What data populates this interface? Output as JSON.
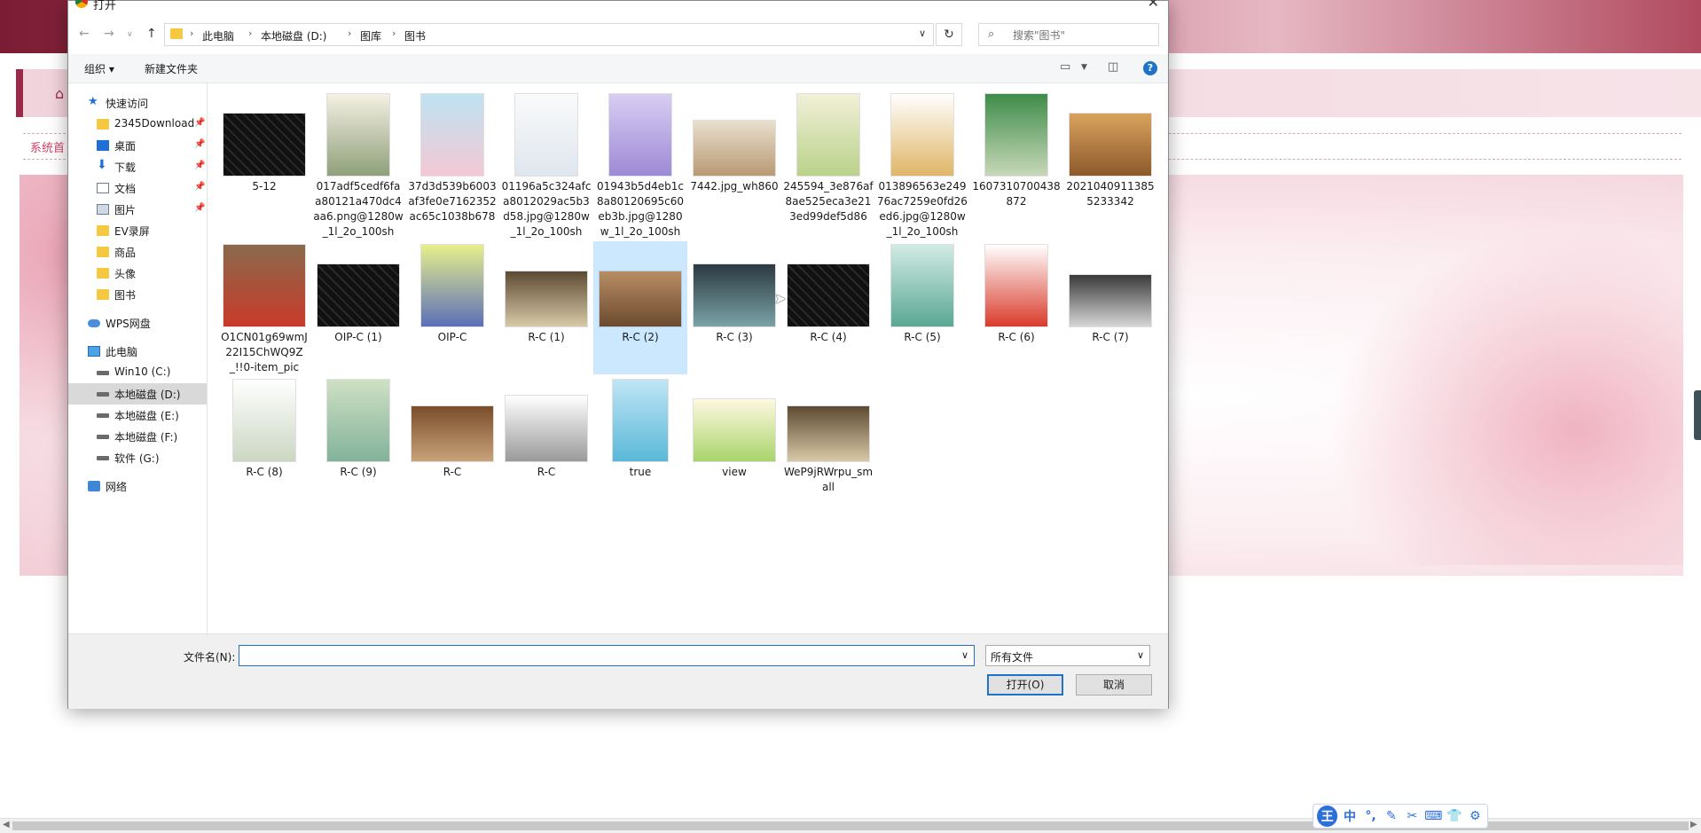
{
  "background_page": {
    "breadcrumb_text": "系统首"
  },
  "dialog": {
    "title": "打开",
    "close_glyph": "✕",
    "address": {
      "crumbs": [
        "此电脑",
        "本地磁盘 (D:)",
        "图库",
        "图书"
      ]
    },
    "search": {
      "placeholder": "搜索\"图书\""
    },
    "toolbar": {
      "organize_label": "组织 ▾",
      "new_folder_label": "新建文件夹",
      "help_label": "?"
    },
    "sidebar": {
      "items": [
        {
          "label": "快速访问",
          "icon": "star-icon",
          "pinned": false
        },
        {
          "label": "2345Download",
          "icon": "folder-icon",
          "pinned": true
        },
        {
          "label": "桌面",
          "icon": "desktop-icon",
          "pinned": true
        },
        {
          "label": "下载",
          "icon": "download-icon",
          "pinned": true
        },
        {
          "label": "文档",
          "icon": "document-icon",
          "pinned": true
        },
        {
          "label": "图片",
          "icon": "pictures-icon",
          "pinned": true
        },
        {
          "label": "EV录屏",
          "icon": "folder-icon",
          "pinned": false
        },
        {
          "label": "商品",
          "icon": "folder-icon",
          "pinned": false
        },
        {
          "label": "头像",
          "icon": "folder-icon",
          "pinned": false
        },
        {
          "label": "图书",
          "icon": "folder-icon",
          "pinned": false
        },
        {
          "label": "WPS网盘",
          "icon": "cloud-icon",
          "pinned": false
        },
        {
          "label": "此电脑",
          "icon": "computer-icon",
          "pinned": false
        },
        {
          "label": "Win10 (C:)",
          "icon": "drive-icon",
          "pinned": false
        },
        {
          "label": "本地磁盘 (D:)",
          "icon": "drive-icon",
          "pinned": false,
          "selected": true
        },
        {
          "label": "本地磁盘 (E:)",
          "icon": "drive-icon",
          "pinned": false
        },
        {
          "label": "本地磁盘 (F:)",
          "icon": "drive-icon",
          "pinned": false
        },
        {
          "label": "软件 (G:)",
          "icon": "drive-icon",
          "pinned": false
        },
        {
          "label": "网络",
          "icon": "network-icon",
          "pinned": false
        }
      ]
    },
    "files": [
      {
        "name": "5-12",
        "thumb": "dark-cad"
      },
      {
        "name": "017adf5cedf6faa80121a470dc4aa6.png@1280w_1l_2o_100sh",
        "thumb": "book-cover-green"
      },
      {
        "name": "37d3d539b6003af3fe0e7162352ac65c1038b678",
        "thumb": "book-cover-blue"
      },
      {
        "name": "01196a5c324afca8012029ac5b3d58.jpg@1280w_1l_2o_100sh",
        "thumb": "book-cover-white"
      },
      {
        "name": "01943b5d4eb1c8a80120695c60eb3b.jpg@1280w_1l_2o_100sh",
        "thumb": "book-cover-purple"
      },
      {
        "name": "7442.jpg_wh860",
        "thumb": "photo-library"
      },
      {
        "name": "245594_3e876af8ae525eca3e213ed99def5d86",
        "thumb": "poster-green"
      },
      {
        "name": "013896563e24976ac7259e0fd26ed6.jpg@1280w_1l_2o_100sh",
        "thumb": "photo-books-yellow"
      },
      {
        "name": "1607310700438872",
        "thumb": "book-cover-darkgreen"
      },
      {
        "name": "20210409113855233342",
        "thumb": "photo-reading"
      },
      {
        "name": "O1CN01g69wmJ22I15ChWQ9Z_!!0-item_pic",
        "thumb": "book-set"
      },
      {
        "name": "OIP-C (1)",
        "thumb": "dark-cad"
      },
      {
        "name": "OIP-C",
        "thumb": "book-cover-flowers"
      },
      {
        "name": "R-C (1)",
        "thumb": "photo-open-book"
      },
      {
        "name": "R-C (2)",
        "thumb": "photo-classroom",
        "selected": true
      },
      {
        "name": "R-C (3)",
        "thumb": "photo-window"
      },
      {
        "name": "R-C (4)",
        "thumb": "dark-cad"
      },
      {
        "name": "R-C (5)",
        "thumb": "book-cover-teal"
      },
      {
        "name": "R-C (6)",
        "thumb": "book-cover-red"
      },
      {
        "name": "R-C (7)",
        "thumb": "photo-glasses"
      },
      {
        "name": "R-C (8)",
        "thumb": "book-cover-plain"
      },
      {
        "name": "R-C (9)",
        "thumb": "book-cover-history"
      },
      {
        "name": "R-C",
        "thumb": "photo-books-stack"
      },
      {
        "name": "R-C",
        "thumb": "sketch-building"
      },
      {
        "name": "true",
        "thumb": "illustration-reading"
      },
      {
        "name": "view",
        "thumb": "poster-health"
      },
      {
        "name": "WeP9jRWrpu_small",
        "thumb": "photo-open-book"
      }
    ],
    "filename": {
      "label": "文件名(N):",
      "value": ""
    },
    "filetype": {
      "value": "所有文件"
    },
    "open_label": "打开(O)",
    "cancel_label": "取消"
  },
  "ime_toolbar": {
    "logo": "王",
    "items": [
      "中",
      "°,",
      "✎",
      "✂",
      "⌨",
      "👕",
      "⚙"
    ]
  },
  "colors": {
    "accent": "#1e73c8",
    "selection": "#cce8ff",
    "brand_bg": "#9a2a4a"
  }
}
